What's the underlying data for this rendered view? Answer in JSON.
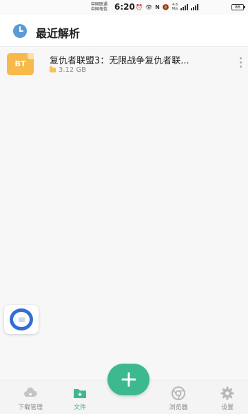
{
  "status_bar": {
    "carrier_1": "中国联通",
    "carrier_2": "中国电信",
    "time": "6:20",
    "net_speed": "4.6\nM/s",
    "battery": "86"
  },
  "header": {
    "title": "最近解析",
    "icon": "clock-icon"
  },
  "files": [
    {
      "type_badge": "BT",
      "name": "复仇者联盟3：无限战争复仇者联...",
      "size": "3.12 GB",
      "size_icon": "folder-icon",
      "menu_icon": "more-vertical-icon"
    }
  ],
  "floating_button": {
    "icon": "floating-ball-icon"
  },
  "fab": {
    "icon": "plus-icon"
  },
  "nav": {
    "items": [
      {
        "label": "下载管理",
        "icon": "cloud-download-icon",
        "active": false
      },
      {
        "label": "文件",
        "icon": "folder-plus-icon",
        "active": true
      },
      {
        "label": "浏览器",
        "icon": "chrome-browser-icon",
        "active": false
      },
      {
        "label": "设置",
        "icon": "gear-icon",
        "active": false
      }
    ]
  },
  "colors": {
    "accent": "#3cb98e",
    "bt_badge": "#f6b94a",
    "float_ring": "#2f6fd6",
    "header_icon": "#5b9bd5"
  }
}
